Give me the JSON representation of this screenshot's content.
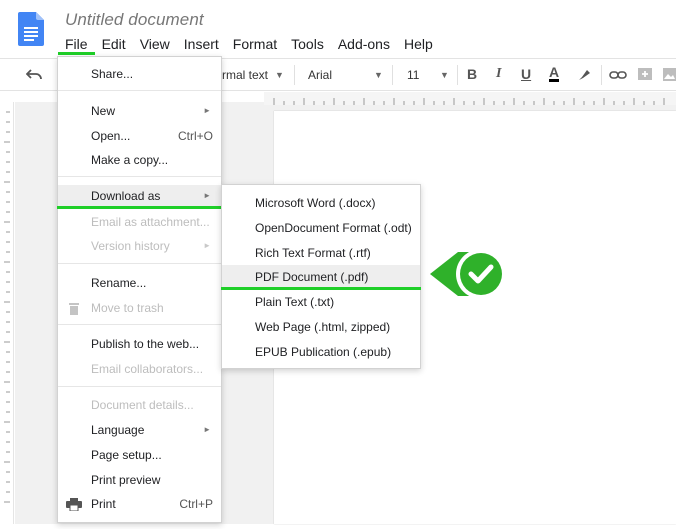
{
  "header": {
    "title": "Untitled document",
    "brand_color": "#4285f4"
  },
  "menubar": {
    "items": [
      {
        "label": "File",
        "active": true
      },
      {
        "label": "Edit"
      },
      {
        "label": "View"
      },
      {
        "label": "Insert"
      },
      {
        "label": "Format"
      },
      {
        "label": "Tools"
      },
      {
        "label": "Add-ons"
      },
      {
        "label": "Help"
      }
    ]
  },
  "toolbar": {
    "style_value": "rmal text",
    "font_value": "Arial",
    "size_value": "11",
    "bold": "B",
    "italic": "I",
    "underline": "U",
    "text_color": "A"
  },
  "file_menu": {
    "items": [
      {
        "label": "Share..."
      },
      {
        "label": "New",
        "submenu": true
      },
      {
        "label": "Open...",
        "shortcut": "Ctrl+O"
      },
      {
        "label": "Make a copy..."
      },
      {
        "label": "Download as",
        "submenu": true,
        "highlighted": true
      },
      {
        "label": "Email as attachment...",
        "disabled": true
      },
      {
        "label": "Version history",
        "submenu": true,
        "disabled": true
      },
      {
        "label": "Rename..."
      },
      {
        "label": "Move to trash",
        "disabled": true,
        "icon": "trash-icon"
      },
      {
        "label": "Publish to the web..."
      },
      {
        "label": "Email collaborators...",
        "disabled": true
      },
      {
        "label": "Document details...",
        "disabled": true
      },
      {
        "label": "Language",
        "submenu": true
      },
      {
        "label": "Page setup..."
      },
      {
        "label": "Print preview"
      },
      {
        "label": "Print",
        "shortcut": "Ctrl+P",
        "icon": "printer-icon"
      }
    ]
  },
  "download_submenu": {
    "items": [
      {
        "label": "Microsoft Word (.docx)"
      },
      {
        "label": "OpenDocument Format (.odt)"
      },
      {
        "label": "Rich Text Format (.rtf)"
      },
      {
        "label": "PDF Document (.pdf)",
        "highlighted": true
      },
      {
        "label": "Plain Text (.txt)"
      },
      {
        "label": "Web Page (.html, zipped)"
      },
      {
        "label": "EPUB Publication (.epub)"
      }
    ]
  },
  "annotation": {
    "icon": "check-icon",
    "accent_color": "#1fcf28"
  }
}
